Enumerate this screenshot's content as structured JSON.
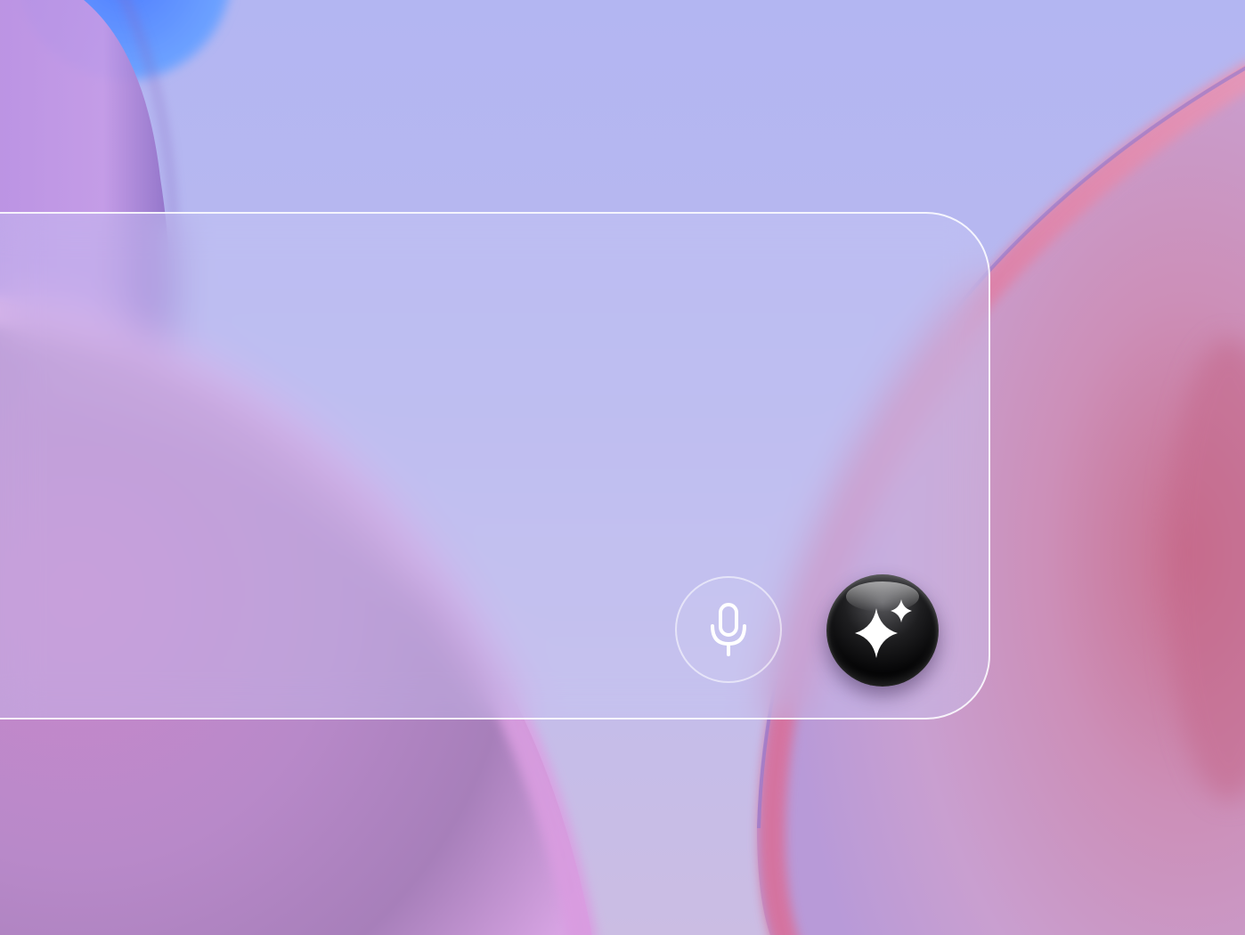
{
  "prompt": {
    "value": "",
    "placeholder": ""
  },
  "icons": {
    "mic": "microphone-icon",
    "generate": "sparkles-icon"
  },
  "colors": {
    "background": "#b5b7f1",
    "blob_pink": "#c98fcf",
    "blob_magenta": "#d46f9e",
    "blob_blue": "#5b8cff",
    "ai_button": "#0a0a0b",
    "icon": "#ffffff"
  }
}
